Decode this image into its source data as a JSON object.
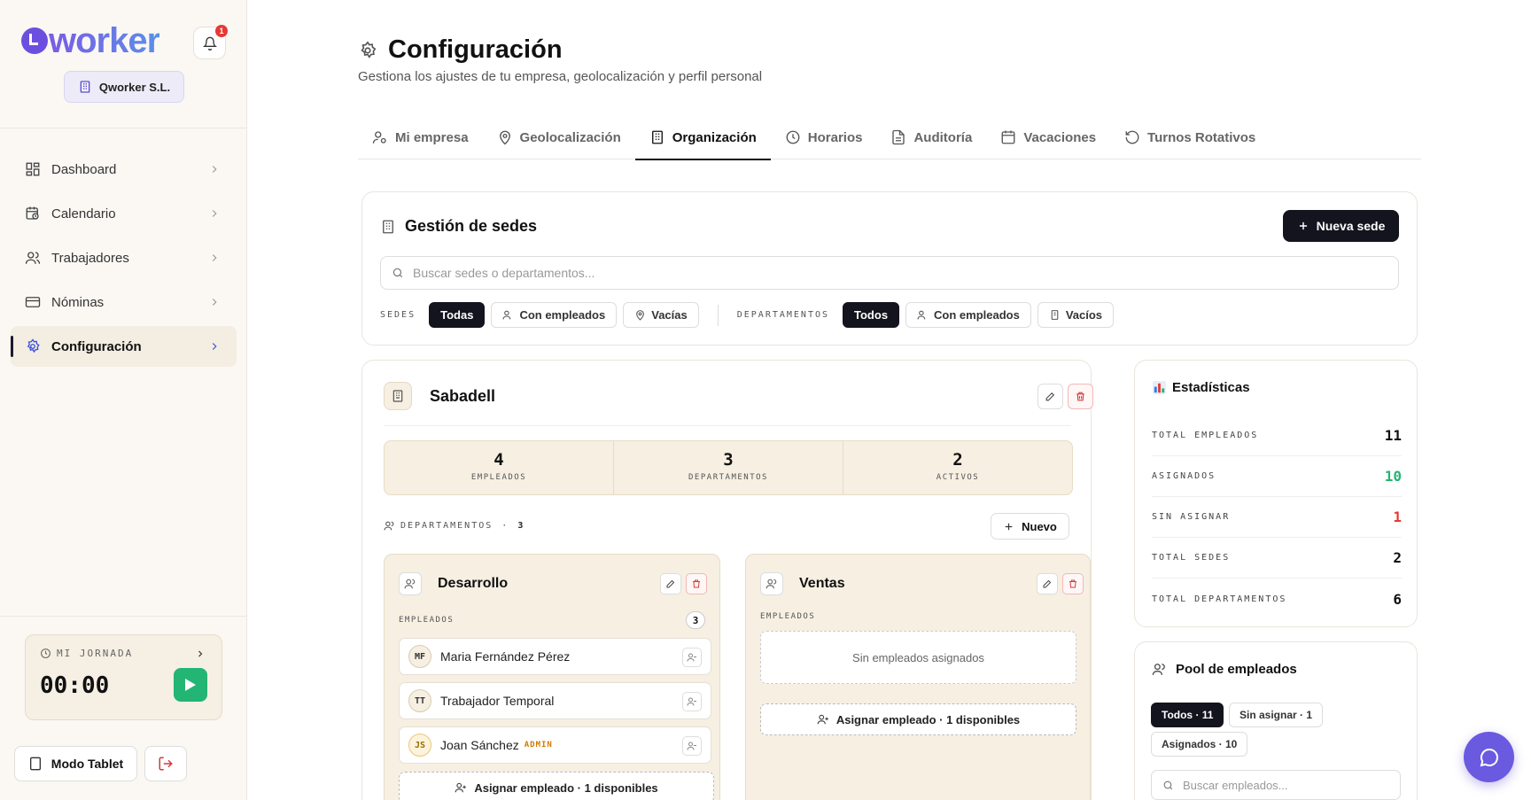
{
  "app": {
    "logo_q": "Q",
    "logo_rest": "worker",
    "notifications": "1",
    "company": "Qworker S.L."
  },
  "nav": [
    {
      "label": "Dashboard"
    },
    {
      "label": "Calendario"
    },
    {
      "label": "Trabajadores"
    },
    {
      "label": "Nóminas"
    },
    {
      "label": "Configuración"
    }
  ],
  "jornada": {
    "label": "MI JORNADA",
    "time": "00:00"
  },
  "footer": {
    "tablet": "Modo Tablet"
  },
  "page": {
    "title": "Configuración",
    "subtitle": "Gestiona los ajustes de tu empresa, geolocalización y perfil personal"
  },
  "tabs": [
    {
      "label": "Mi empresa"
    },
    {
      "label": "Geolocalización"
    },
    {
      "label": "Organización"
    },
    {
      "label": "Horarios"
    },
    {
      "label": "Auditoría"
    },
    {
      "label": "Vacaciones"
    },
    {
      "label": "Turnos Rotativos"
    }
  ],
  "sedes": {
    "title": "Gestión de sedes",
    "new_button": "Nueva sede",
    "search_placeholder": "Buscar sedes o departamentos...",
    "sedes_label": "SEDES",
    "sedes_filters": [
      "Todas",
      "Con empleados",
      "Vacías"
    ],
    "dept_label": "DEPARTAMENTOS",
    "dept_filters": [
      "Todos",
      "Con empleados",
      "Vacíos"
    ]
  },
  "sede": {
    "name": "Sabadell",
    "stats": [
      {
        "value": "4",
        "label": "EMPLEADOS"
      },
      {
        "value": "3",
        "label": "DEPARTAMENTOS"
      },
      {
        "value": "2",
        "label": "ACTIVOS"
      }
    ],
    "dept_header": "DEPARTAMENTOS",
    "dept_sep": "·",
    "dept_count": "3",
    "new_button": "Nuevo",
    "departments": [
      {
        "name": "Desarrollo",
        "employees_label": "EMPLEADOS",
        "count": "3",
        "employees": [
          {
            "initials": "MF",
            "name": "Maria Fernández Pérez",
            "tag": ""
          },
          {
            "initials": "TT",
            "name": "Trabajador Temporal",
            "tag": ""
          },
          {
            "initials": "JS",
            "name": "Joan Sánchez",
            "tag": "ADMIN"
          }
        ],
        "assign": "Asignar empleado · 1 disponibles"
      },
      {
        "name": "Ventas",
        "employees_label": "EMPLEADOS",
        "empty": "Sin empleados asignados",
        "assign": "Asignar empleado · 1 disponibles"
      }
    ]
  },
  "stats": {
    "title": "Estadísticas",
    "rows": [
      {
        "label": "TOTAL EMPLEADOS",
        "value": "11"
      },
      {
        "label": "ASIGNADOS",
        "value": "10"
      },
      {
        "label": "SIN ASIGNAR",
        "value": "1"
      },
      {
        "label": "TOTAL SEDES",
        "value": "2"
      },
      {
        "label": "TOTAL DEPARTAMENTOS",
        "value": "6"
      }
    ],
    "colors": {
      "asignados": "#22b573",
      "sin_asignar": "#e53935"
    }
  },
  "pool": {
    "title": "Pool de empleados",
    "filters": [
      "Todos · 11",
      "Sin asignar · 1",
      "Asignados · 10"
    ],
    "search_placeholder": "Buscar empleados..."
  }
}
